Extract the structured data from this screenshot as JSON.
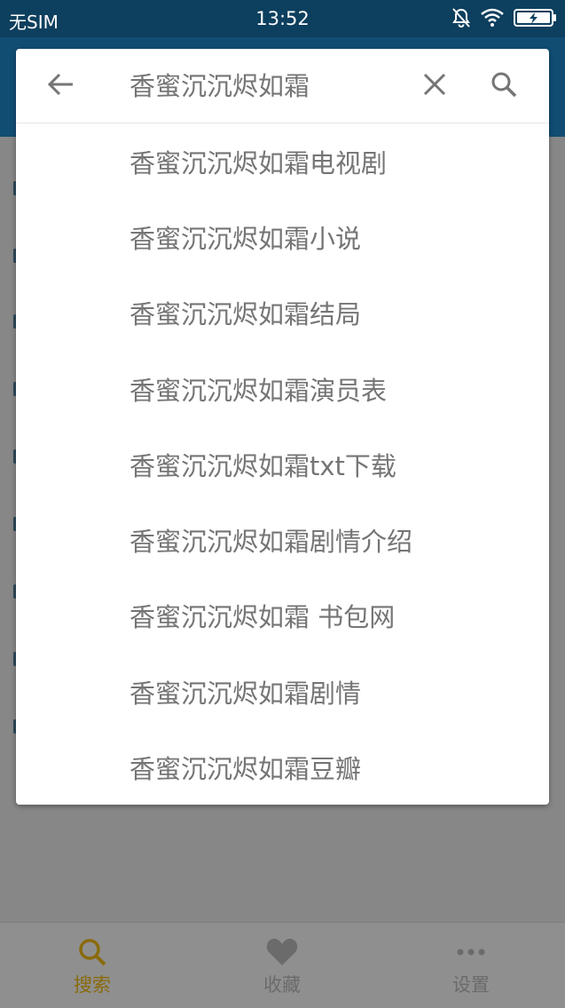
{
  "status_bar": {
    "carrier": "无SIM",
    "time": "13:52",
    "icons": [
      "bell-muted-icon",
      "wifi-icon",
      "battery-charging-icon"
    ]
  },
  "search": {
    "query": "香蜜沉沉烬如霜",
    "back_icon": "arrow-left-icon",
    "clear_icon": "close-icon",
    "search_icon": "search-icon"
  },
  "suggestions": [
    "香蜜沉沉烬如霜电视剧",
    "香蜜沉沉烬如霜小说",
    "香蜜沉沉烬如霜结局",
    "香蜜沉沉烬如霜演员表",
    "香蜜沉沉烬如霜txt下载",
    "香蜜沉沉烬如霜剧情介绍",
    "香蜜沉沉烬如霜 书包网",
    "香蜜沉沉烬如霜剧情",
    "香蜜沉沉烬如霜豆瓣"
  ],
  "bottom_nav": {
    "items": [
      {
        "label": "搜索",
        "icon": "search-icon",
        "active": true
      },
      {
        "label": "收藏",
        "icon": "heart-icon",
        "active": false
      },
      {
        "label": "设置",
        "icon": "more-dots-icon",
        "active": false
      }
    ]
  },
  "colors": {
    "status_bar": "#0d3f5e",
    "app_bar": "#114d73",
    "active_tab": "#8a6a0a",
    "suggestion_text": "#757575"
  }
}
